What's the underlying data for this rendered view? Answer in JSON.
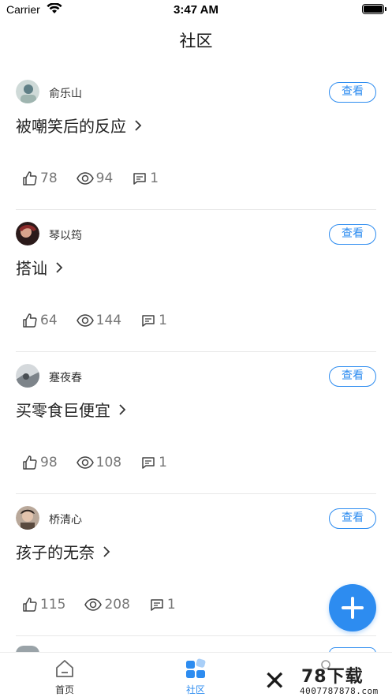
{
  "status_bar": {
    "carrier": "Carrier",
    "time": "3:47 AM"
  },
  "nav": {
    "title": "社区"
  },
  "posts": [
    {
      "author": "俞乐山",
      "view_label": "查看",
      "title": "被嘲笑后的反应",
      "likes": "78",
      "views": "94",
      "comments": "1",
      "avatar_color": "#5f7f86"
    },
    {
      "author": "琴以筠",
      "view_label": "查看",
      "title": "搭讪",
      "likes": "64",
      "views": "144",
      "comments": "1",
      "avatar_color": "#8b2a2a"
    },
    {
      "author": "蹇夜春",
      "view_label": "查看",
      "title": "买零食巨便宜",
      "likes": "98",
      "views": "108",
      "comments": "1",
      "avatar_color": "#7d848a"
    },
    {
      "author": "桥清心",
      "view_label": "查看",
      "title": "孩子的无奈",
      "likes": "115",
      "views": "208",
      "comments": "1",
      "avatar_color": "#5a4a3f"
    }
  ],
  "tabs": [
    {
      "label": "首页"
    },
    {
      "label": "社区"
    }
  ],
  "watermark": {
    "brand": "78下载",
    "url": "4007787878.com"
  },
  "colors": {
    "accent": "#2d8cf0",
    "text": "#222222",
    "muted": "#777777"
  }
}
